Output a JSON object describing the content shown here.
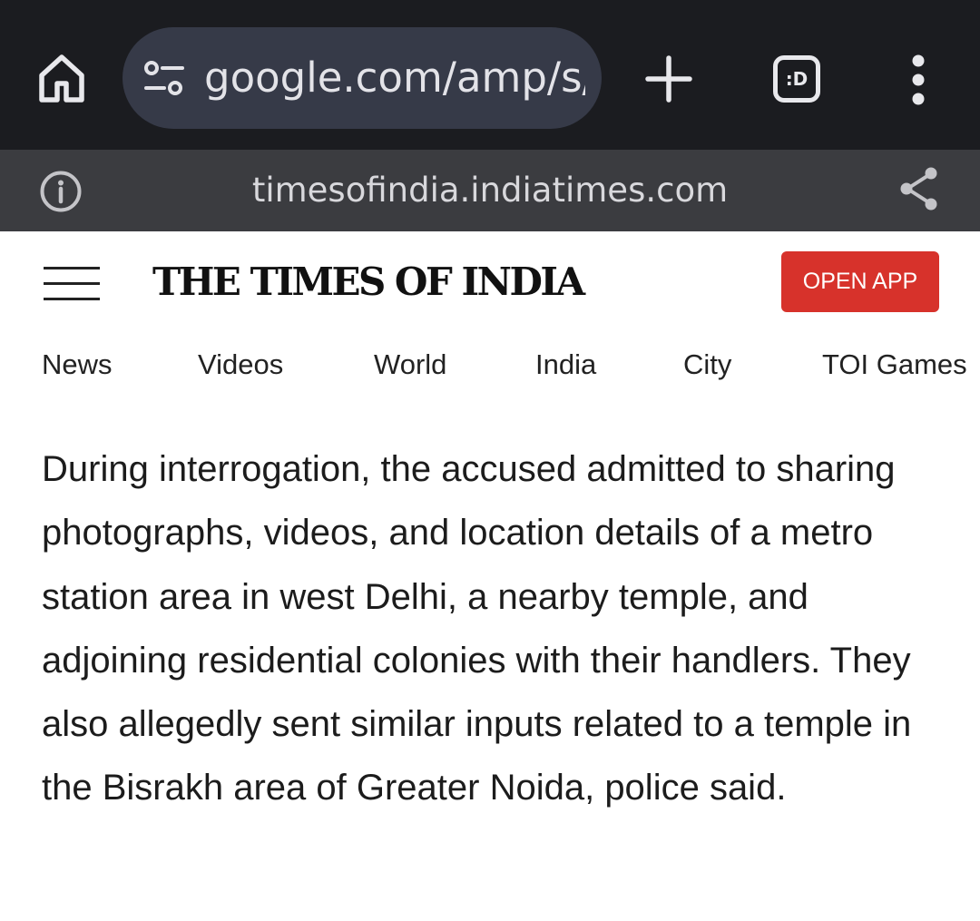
{
  "browser": {
    "url_text": "google.com/amp/s/ti",
    "tabs_badge": ":D",
    "icons": [
      "home-icon",
      "tune-icon",
      "plus-icon",
      "tab-switcher-icon",
      "more-vert-icon"
    ]
  },
  "infobar": {
    "domain": "timesofindia.indiatimes.com",
    "icons": [
      "info-icon",
      "share-icon"
    ]
  },
  "site": {
    "masthead": "THE TIMES OF INDIA",
    "open_app_label": "OPEN APP",
    "accent_color": "#d7322b"
  },
  "nav": {
    "items": [
      "News",
      "Videos",
      "World",
      "India",
      "City",
      "TOI Games"
    ]
  },
  "article": {
    "paragraph": "During interrogation, the accused admitted to sharing photographs, videos, and location details of a metro station area in west Delhi, a nearby temple, and adjoining residential colonies with their handlers. They also allegedly sent similar inputs related to a temple in the Bisrakh area of Greater Noida, police said."
  }
}
